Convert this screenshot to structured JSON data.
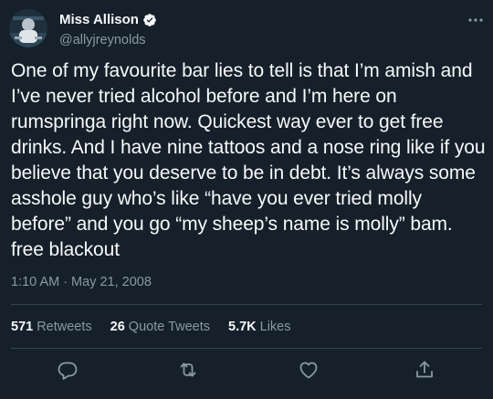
{
  "author": {
    "display_name": "Miss Allison",
    "handle": "@allyjreynolds",
    "verified": true
  },
  "tweet": {
    "text": "One of my favourite bar lies to tell is that I’m amish and I’ve never tried alcohol before and I’m here on rumspringa right now. Quickest way ever to get free drinks. And I have nine tattoos and a nose ring like if you believe that you deserve to be in debt. It’s always some asshole guy who’s like “have you ever tried molly before” and you go “my sheep’s name is molly” bam. free blackout",
    "time": "1:10 AM",
    "separator": "·",
    "date": "May 21, 2008"
  },
  "stats": {
    "retweets": {
      "count": "571",
      "label": "Retweets"
    },
    "quotes": {
      "count": "26",
      "label": "Quote Tweets"
    },
    "likes": {
      "count": "5.7K",
      "label": "Likes"
    }
  },
  "actions": [
    "reply-icon",
    "retweet-icon",
    "like-icon",
    "share-icon"
  ],
  "colors": {
    "background": "#15202b",
    "text": "#f7f9f9",
    "secondary": "#8b98a5",
    "divider": "#38444d",
    "verified": "#f7f9f9"
  }
}
